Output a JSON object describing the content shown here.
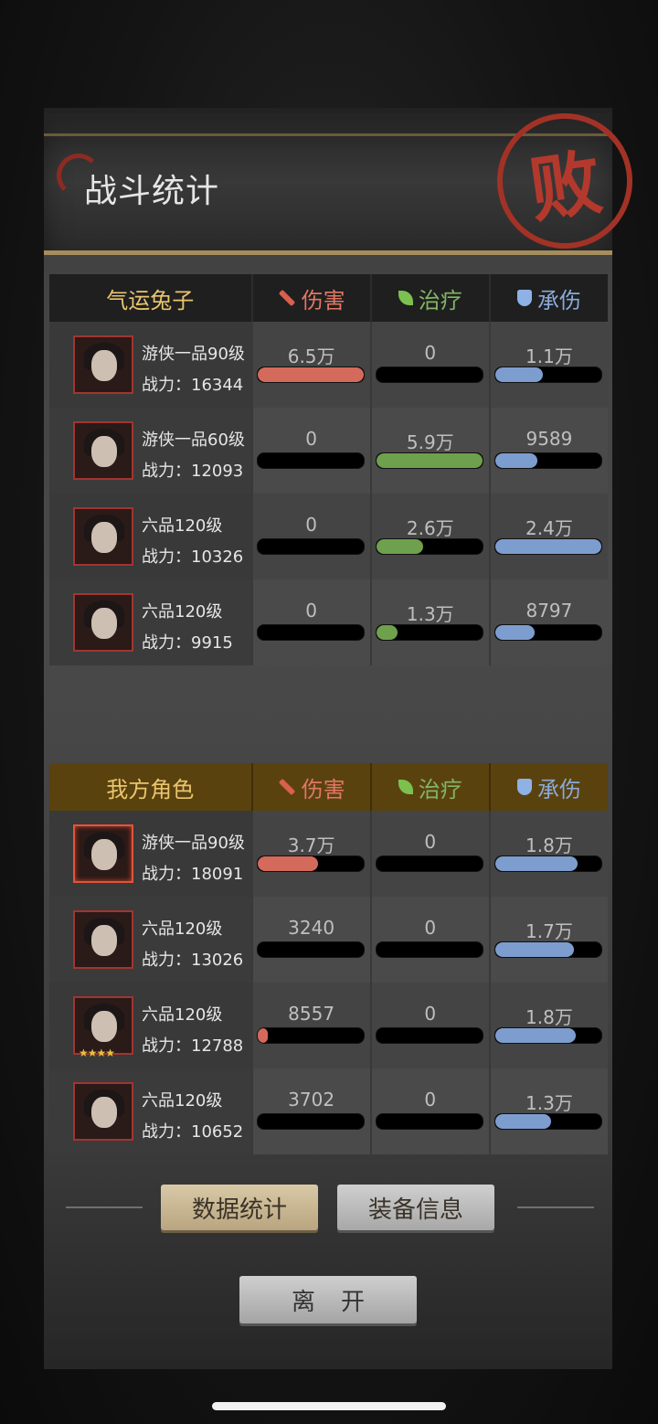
{
  "header": {
    "title": "战斗统计",
    "result_seal": "败"
  },
  "enemy": {
    "team_name": "气运兔子",
    "columns": {
      "damage": "伤害",
      "heal": "治疗",
      "tank": "承伤"
    },
    "rows": [
      {
        "rank": "游侠一品90级",
        "power": "战力：16344",
        "damage": "6.5万",
        "heal": "0",
        "tank": "1.1万",
        "damage_fill": 1.0,
        "heal_fill": 0.0,
        "tank_fill": 0.45,
        "stars": ""
      },
      {
        "rank": "游侠一品60级",
        "power": "战力：12093",
        "damage": "0",
        "heal": "5.9万",
        "tank": "9589",
        "damage_fill": 0.0,
        "heal_fill": 1.0,
        "tank_fill": 0.4,
        "stars": ""
      },
      {
        "rank": "六品120级",
        "power": "战力：10326",
        "damage": "0",
        "heal": "2.6万",
        "tank": "2.4万",
        "damage_fill": 0.0,
        "heal_fill": 0.44,
        "tank_fill": 1.0,
        "stars": ""
      },
      {
        "rank": "六品120级",
        "power": "战力：9915",
        "damage": "0",
        "heal": "1.3万",
        "tank": "8797",
        "damage_fill": 0.0,
        "heal_fill": 0.2,
        "tank_fill": 0.37,
        "stars": ""
      }
    ]
  },
  "ally": {
    "team_name": "我方角色",
    "columns": {
      "damage": "伤害",
      "heal": "治疗",
      "tank": "承伤"
    },
    "rows": [
      {
        "rank": "游侠一品90级",
        "power": "战力：18091",
        "damage": "3.7万",
        "heal": "0",
        "tank": "1.8万",
        "damage_fill": 0.57,
        "heal_fill": 0.0,
        "tank_fill": 0.78,
        "stars": "",
        "highlight": true
      },
      {
        "rank": "六品120级",
        "power": "战力：13026",
        "damage": "3240",
        "heal": "0",
        "tank": "1.7万",
        "damage_fill": 0.0,
        "heal_fill": 0.0,
        "tank_fill": 0.74,
        "stars": ""
      },
      {
        "rank": "六品120级",
        "power": "战力：12788",
        "damage": "8557",
        "heal": "0",
        "tank": "1.8万",
        "damage_fill": 0.1,
        "heal_fill": 0.0,
        "tank_fill": 0.76,
        "stars": "★★★★"
      },
      {
        "rank": "六品120级",
        "power": "战力：10652",
        "damage": "3702",
        "heal": "0",
        "tank": "1.3万",
        "damage_fill": 0.0,
        "heal_fill": 0.0,
        "tank_fill": 0.53,
        "stars": ""
      }
    ]
  },
  "buttons": {
    "data_stats": "数据统计",
    "equipment_info": "装备信息",
    "leave": "离开"
  },
  "colors": {
    "damage": "#d46a5c",
    "heal": "#6ea04d",
    "tank": "#7d9dcf",
    "seal": "#a33226",
    "ally_header": "#5a420f"
  }
}
